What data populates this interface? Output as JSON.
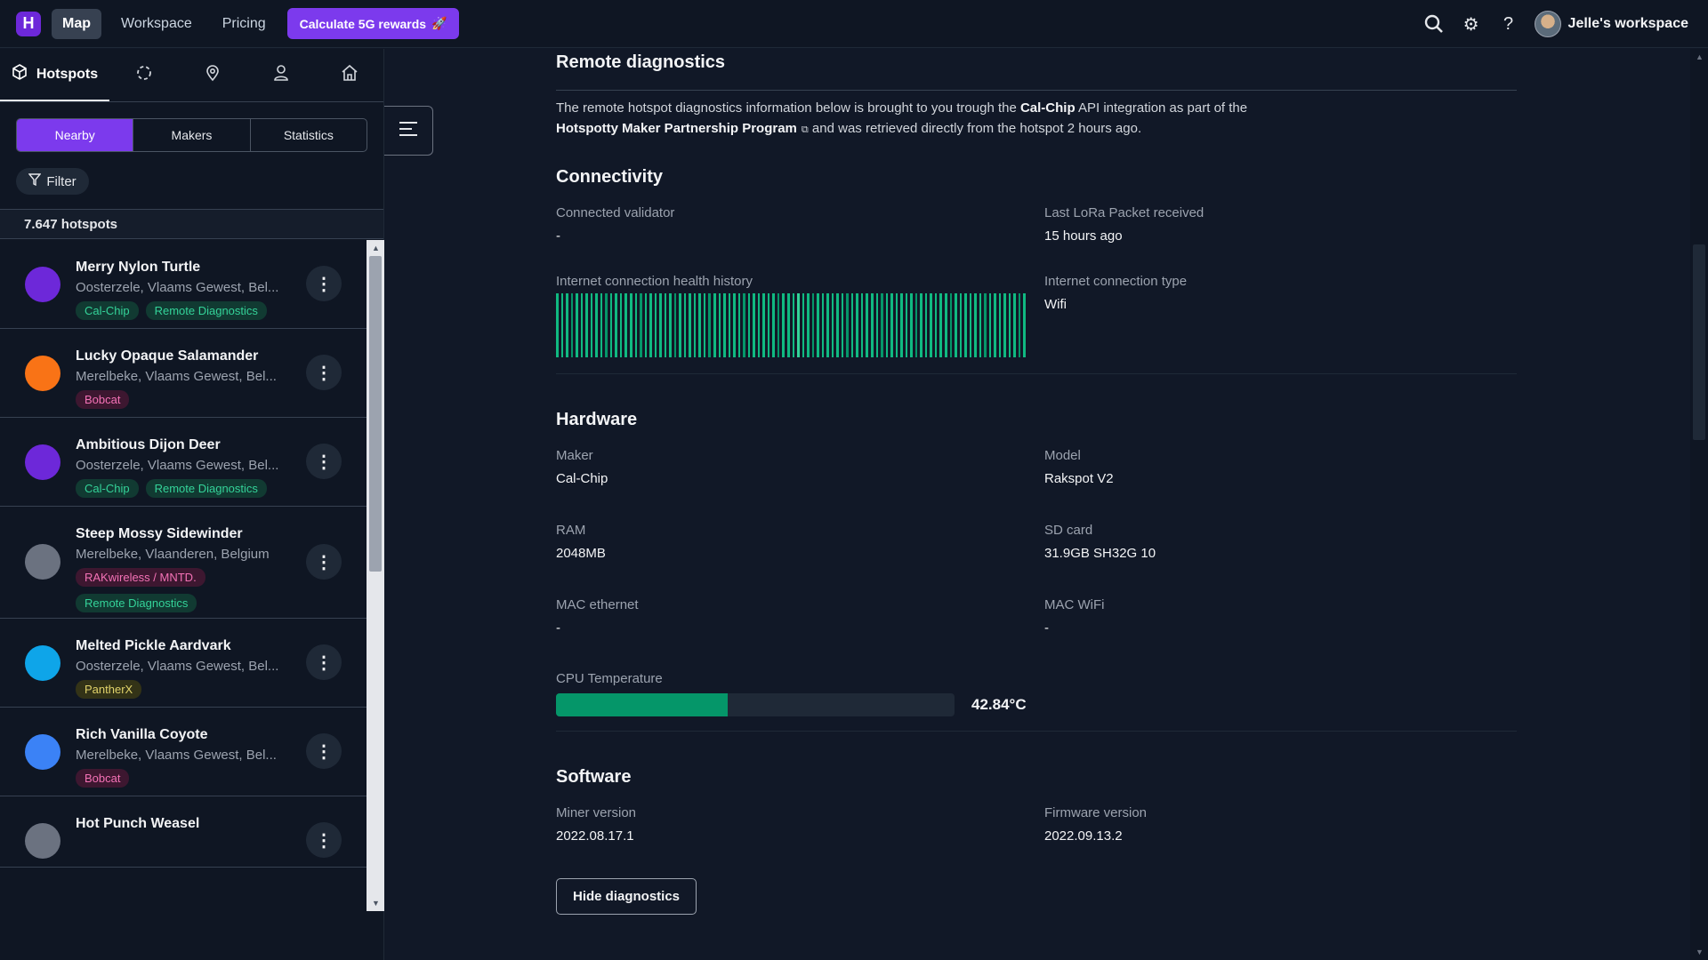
{
  "topnav": {
    "logo": "H",
    "links": [
      "Map",
      "Workspace",
      "Pricing"
    ],
    "cta": "Calculate 5G rewards",
    "workspace": "Jelle's workspace"
  },
  "sidebar": {
    "tabs": {
      "hotspots": "Hotspots"
    },
    "segments": [
      "Nearby",
      "Makers",
      "Statistics"
    ],
    "filter": "Filter",
    "count": "7.647 hotspots",
    "items": [
      {
        "name": "Merry Nylon Turtle",
        "location": "Oosterzele, Vlaams Gewest, Bel...",
        "tags": [
          {
            "label": "Cal-Chip",
            "color": "teal"
          },
          {
            "label": "Remote Diagnostics",
            "color": "teal"
          }
        ],
        "bot_color": "#6d28d9"
      },
      {
        "name": "Lucky Opaque Salamander",
        "location": "Merelbeke, Vlaams Gewest, Bel...",
        "tags": [
          {
            "label": "Bobcat",
            "color": "pink"
          }
        ],
        "bot_color": "#f97316"
      },
      {
        "name": "Ambitious Dijon Deer",
        "location": "Oosterzele, Vlaams Gewest, Bel...",
        "tags": [
          {
            "label": "Cal-Chip",
            "color": "teal"
          },
          {
            "label": "Remote Diagnostics",
            "color": "teal"
          }
        ],
        "bot_color": "#6d28d9"
      },
      {
        "name": "Steep Mossy Sidewinder",
        "location": "Merelbeke, Vlaanderen, Belgium",
        "tags": [
          {
            "label": "RAKwireless / MNTD.",
            "color": "pink"
          },
          {
            "label": "Remote Diagnostics",
            "color": "teal"
          }
        ],
        "bot_color": "#6b7280"
      },
      {
        "name": "Melted Pickle Aardvark",
        "location": "Oosterzele, Vlaams Gewest, Bel...",
        "tags": [
          {
            "label": "PantherX",
            "color": "yellow"
          }
        ],
        "bot_color": "#0ea5e9"
      },
      {
        "name": "Rich Vanilla Coyote",
        "location": "Merelbeke, Vlaams Gewest, Bel...",
        "tags": [
          {
            "label": "Bobcat",
            "color": "pink"
          }
        ],
        "bot_color": "#3b82f6"
      },
      {
        "name": "Hot Punch Weasel",
        "location": "",
        "tags": [],
        "bot_color": "#6b7280"
      }
    ]
  },
  "main": {
    "title": "Remote diagnostics",
    "intro": {
      "p1": "The remote hotspot diagnostics information below is brought to you trough the ",
      "b1": "Cal-Chip",
      "p2": " API integration as part of the",
      "b2": "Hotspotty Maker Partnership Program",
      "p3": " and was retrieved directly from the hotspot 2 hours ago."
    },
    "connectivity": {
      "title": "Connectivity",
      "validator_label": "Connected validator",
      "validator_value": "-",
      "lora_label": "Last LoRa Packet received",
      "lora_value": "15 hours ago",
      "health_label": "Internet connection health history",
      "conn_type_label": "Internet connection type",
      "conn_type_value": "Wifi"
    },
    "hardware": {
      "title": "Hardware",
      "maker_label": "Maker",
      "maker_value": "Cal-Chip",
      "model_label": "Model",
      "model_value": "Rakspot V2",
      "ram_label": "RAM",
      "ram_value": "2048MB",
      "sd_label": "SD card",
      "sd_value": "31.9GB SH32G 10",
      "mac_eth_label": "MAC ethernet",
      "mac_eth_value": "-",
      "mac_wifi_label": "MAC WiFi",
      "mac_wifi_value": "-",
      "cpu_label": "CPU Temperature",
      "cpu_value": "42.84°C",
      "cpu_fraction": 0.43
    },
    "software": {
      "title": "Software",
      "miner_label": "Miner version",
      "miner_value": "2022.08.17.1",
      "firmware_label": "Firmware version",
      "firmware_value": "2022.09.13.2"
    },
    "hide_button": "Hide diagnostics"
  },
  "colors": {
    "accent": "#7c3aed",
    "health": "#10b981",
    "background": "#111827"
  }
}
